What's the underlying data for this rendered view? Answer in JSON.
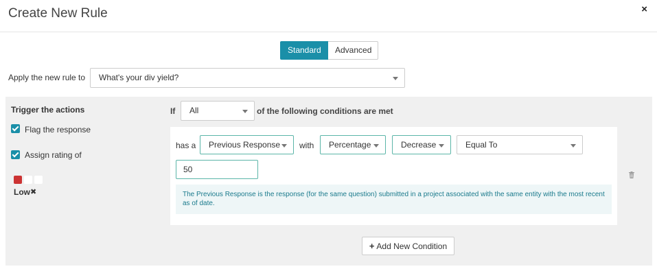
{
  "dialog": {
    "title": "Create New Rule",
    "close_icon": "×"
  },
  "mode": {
    "standard_label": "Standard",
    "advanced_label": "Advanced",
    "active": "Standard"
  },
  "apply": {
    "label": "Apply the new rule to",
    "value": "What's your div yield?"
  },
  "trigger": {
    "title": "Trigger the actions",
    "flag_label": "Flag the response",
    "flag_checked": true,
    "rating_label": "Assign rating of",
    "rating_checked": true,
    "rating_value": "Low",
    "rating_colors": [
      "#cc3333",
      "#ffffff",
      "#ffffff"
    ]
  },
  "condition": {
    "if_label": "If",
    "match_value": "All",
    "match_suffix": "of the following conditions are met",
    "has_a_label": "has a",
    "source_value": "Previous Response",
    "with_label": "with",
    "measure_value": "Percentage",
    "direction_value": "Decrease",
    "operator_value": "Equal To",
    "input_value": "50",
    "info_text": "The Previous Response is the response (for the same question) submitted in a project associated with the same entity with the most recent as of date."
  },
  "add_condition": {
    "label": "Add New Condition",
    "icon": "plus-icon"
  },
  "colors": {
    "accent": "#1a8fa8",
    "field_border": "#5bb5a8",
    "info_bg": "#eef6f7",
    "info_text": "#1a7a8c"
  }
}
